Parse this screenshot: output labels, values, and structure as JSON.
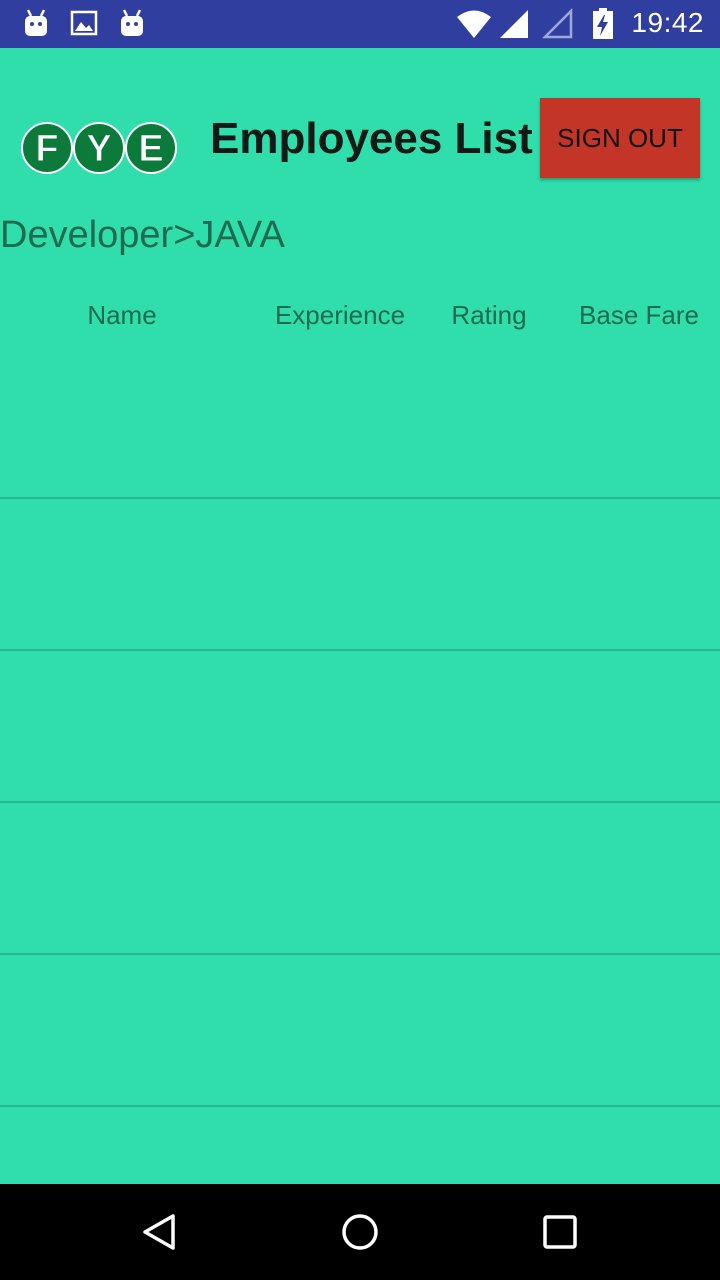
{
  "status_bar": {
    "time": "19:42",
    "icons": [
      "android-icon",
      "image-icon",
      "android-icon",
      "wifi-icon",
      "signal-icon",
      "signal-empty-icon",
      "battery-charging-icon"
    ]
  },
  "header": {
    "logo_letters": [
      "F",
      "Y",
      "E"
    ],
    "title": "Employees List",
    "sign_out_label": "SIGN OUT"
  },
  "breadcrumb": "Developer>JAVA",
  "table": {
    "columns": [
      "Name",
      "Experience",
      "Rating",
      "Base Fare"
    ],
    "rows": [
      [],
      [],
      [],
      [],
      []
    ]
  },
  "nav_bar": {
    "buttons": [
      "back-icon",
      "home-icon",
      "recents-icon"
    ]
  },
  "colors": {
    "status_bar": "#303f9f",
    "background": "#2fdeaa",
    "sign_out_button": "#c33527",
    "logo_green": "#0b7a3b",
    "divider": "#27b98d",
    "nav_bar": "#000000"
  }
}
